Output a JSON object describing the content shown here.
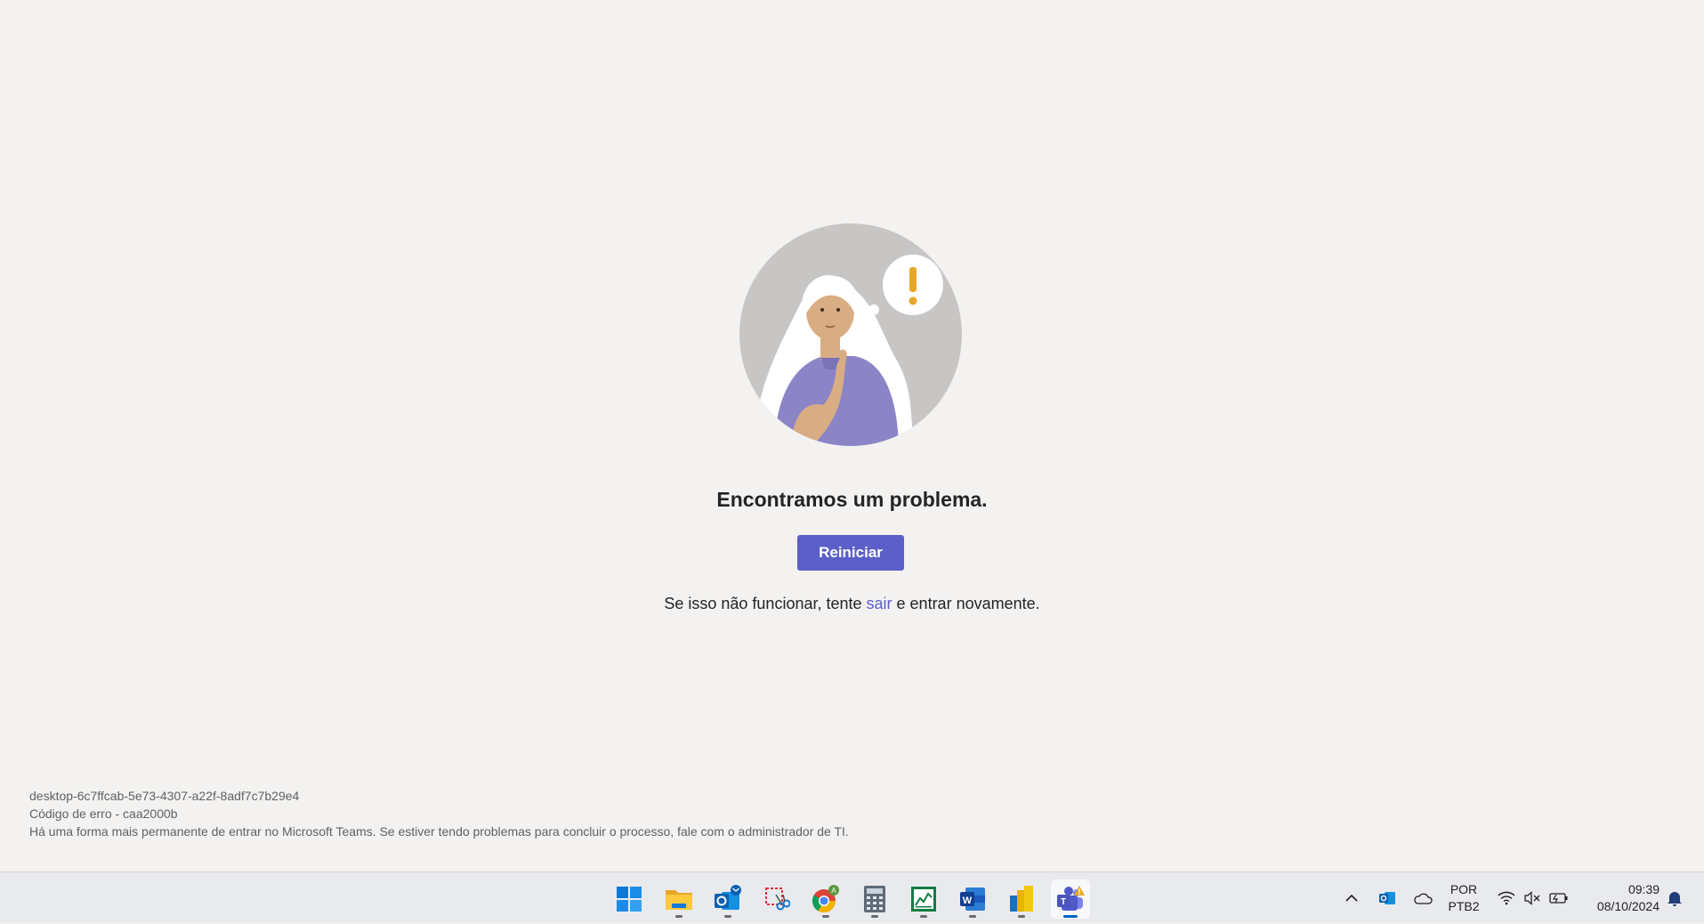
{
  "error_page": {
    "title": "Encontramos um problema.",
    "restart_label": "Reiniciar",
    "hint_prefix": "Se isso não funcionar, tente ",
    "hint_link": "sair",
    "hint_suffix": " e entrar novamente.",
    "session_id": "desktop-6c7ffcab-5e73-4307-a22f-8adf7c7b29e4",
    "error_code": "Código de erro - caa2000b",
    "admin_note": "Há uma forma mais permanente de entrar no Microsoft Teams. Se estiver tendo problemas para concluir o processo, fale com o administrador de TI."
  },
  "colors": {
    "accent": "#5b5fc7",
    "background": "#f3f2f1",
    "warning": "#e8a628"
  },
  "taskbar": {
    "apps": [
      {
        "name": "windows-start-icon"
      },
      {
        "name": "file-explorer-icon"
      },
      {
        "name": "outlook-icon"
      },
      {
        "name": "snipping-tool-icon"
      },
      {
        "name": "chrome-icon"
      },
      {
        "name": "calculator-icon"
      },
      {
        "name": "excel-chart-icon"
      },
      {
        "name": "word-icon"
      },
      {
        "name": "power-bi-icon"
      },
      {
        "name": "teams-icon"
      }
    ],
    "tray": {
      "language_line1": "POR",
      "language_line2": "PTB2",
      "time": "09:39",
      "date": "08/10/2024"
    }
  }
}
